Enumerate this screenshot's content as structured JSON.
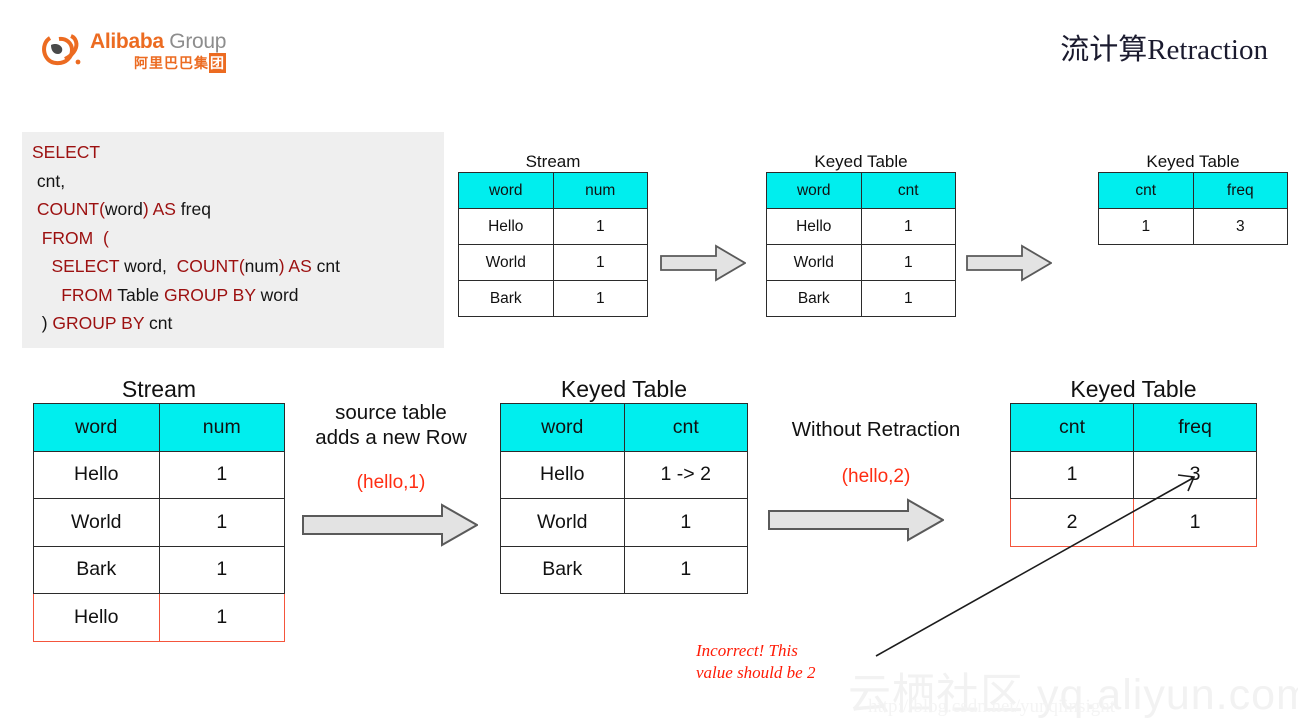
{
  "header": {
    "logo": {
      "brand_en": "Alibaba",
      "brand_group": " Group",
      "brand_cn": "阿里巴巴集",
      "brand_cn_boxed": "团",
      "icon": "alibaba-swirl-logo"
    },
    "deck_title": "流计算Retraction"
  },
  "sql": {
    "lines": [
      [
        {
          "t": "SELECT",
          "kw": true
        }
      ],
      [
        {
          "t": " cnt,",
          "kw": false
        }
      ],
      [
        {
          "t": " ",
          "kw": false
        },
        {
          "t": "COUNT(",
          "kw": true
        },
        {
          "t": "word",
          "kw": false
        },
        {
          "t": ") AS ",
          "kw": true
        },
        {
          "t": "freq",
          "kw": false
        }
      ],
      [
        {
          "t": "  ",
          "kw": false
        },
        {
          "t": "FROM  (",
          "kw": true
        }
      ],
      [
        {
          "t": "    ",
          "kw": false
        },
        {
          "t": "SELECT ",
          "kw": true
        },
        {
          "t": "word,  ",
          "kw": false
        },
        {
          "t": "COUNT(",
          "kw": true
        },
        {
          "t": "num",
          "kw": false
        },
        {
          "t": ") AS ",
          "kw": true
        },
        {
          "t": "cnt",
          "kw": false
        }
      ],
      [
        {
          "t": "      ",
          "kw": false
        },
        {
          "t": "FROM ",
          "kw": true
        },
        {
          "t": "Table ",
          "kw": false
        },
        {
          "t": "GROUP BY ",
          "kw": true
        },
        {
          "t": "word",
          "kw": false
        }
      ],
      [
        {
          "t": "  ) ",
          "kw": false
        },
        {
          "t": "GROUP BY ",
          "kw": true
        },
        {
          "t": "cnt",
          "kw": false
        }
      ]
    ]
  },
  "tables": {
    "stream_top": {
      "title": "Stream",
      "headers": [
        "word",
        "num"
      ],
      "rows": [
        {
          "cells": [
            "Hello",
            "1"
          ],
          "highlight": false
        },
        {
          "cells": [
            "World",
            "1"
          ],
          "highlight": false
        },
        {
          "cells": [
            "Bark",
            "1"
          ],
          "highlight": false
        }
      ]
    },
    "keyed_top": {
      "title": "Keyed Table",
      "headers": [
        "word",
        "cnt"
      ],
      "rows": [
        {
          "cells": [
            "Hello",
            "1"
          ],
          "highlight": false
        },
        {
          "cells": [
            "World",
            "1"
          ],
          "highlight": false
        },
        {
          "cells": [
            "Bark",
            "1"
          ],
          "highlight": false
        }
      ]
    },
    "freq_top": {
      "title": "Keyed Table",
      "headers": [
        "cnt",
        "freq"
      ],
      "rows": [
        {
          "cells": [
            "1",
            "3"
          ],
          "highlight": false
        }
      ]
    },
    "stream_bottom": {
      "title": "Stream",
      "headers": [
        "word",
        "num"
      ],
      "rows": [
        {
          "cells": [
            "Hello",
            "1"
          ],
          "highlight": false
        },
        {
          "cells": [
            "World",
            "1"
          ],
          "highlight": false
        },
        {
          "cells": [
            "Bark",
            "1"
          ],
          "highlight": false
        },
        {
          "cells": [
            "Hello",
            "1"
          ],
          "highlight": true
        }
      ]
    },
    "keyed_bottom": {
      "title": "Keyed Table",
      "headers": [
        "word",
        "cnt"
      ],
      "rows": [
        {
          "cells": [
            "Hello",
            "1 -> 2"
          ],
          "highlight": false,
          "red_cells": [
            1
          ]
        },
        {
          "cells": [
            "World",
            "1"
          ],
          "highlight": false
        },
        {
          "cells": [
            "Bark",
            "1"
          ],
          "highlight": false
        }
      ]
    },
    "freq_bottom": {
      "title": "Keyed Table",
      "headers": [
        "cnt",
        "freq"
      ],
      "rows": [
        {
          "cells": [
            "1",
            "3"
          ],
          "highlight": false
        },
        {
          "cells": [
            "2",
            "1"
          ],
          "highlight": true
        }
      ]
    }
  },
  "annotations": {
    "source_table": "source table\nadds a new Row",
    "source_table_pair": "(hello,1)",
    "without_retraction": "Without Retraction",
    "without_retraction_pair": "(hello,2)",
    "incorrect_note": "Incorrect! This\nvalue should be 2"
  },
  "arrows": {
    "top_1": "block-arrow-right-icon",
    "top_2": "block-arrow-right-icon",
    "bottom_1": "block-arrow-right-icon",
    "bottom_2": "block-arrow-right-icon",
    "pointer": "callout-pointer-line-icon"
  },
  "watermark": {
    "big": "云栖社区 yq.aliyun.com",
    "small": "http://blog.csdn.net/yunqiinsight"
  },
  "colors": {
    "header_cell": "#00EEEE",
    "keyword": "#9C1010",
    "highlight": "#F4553C",
    "red_text": "#FF2D12",
    "brand_orange": "#EC6B21",
    "sql_bg": "#EFEFEF"
  }
}
